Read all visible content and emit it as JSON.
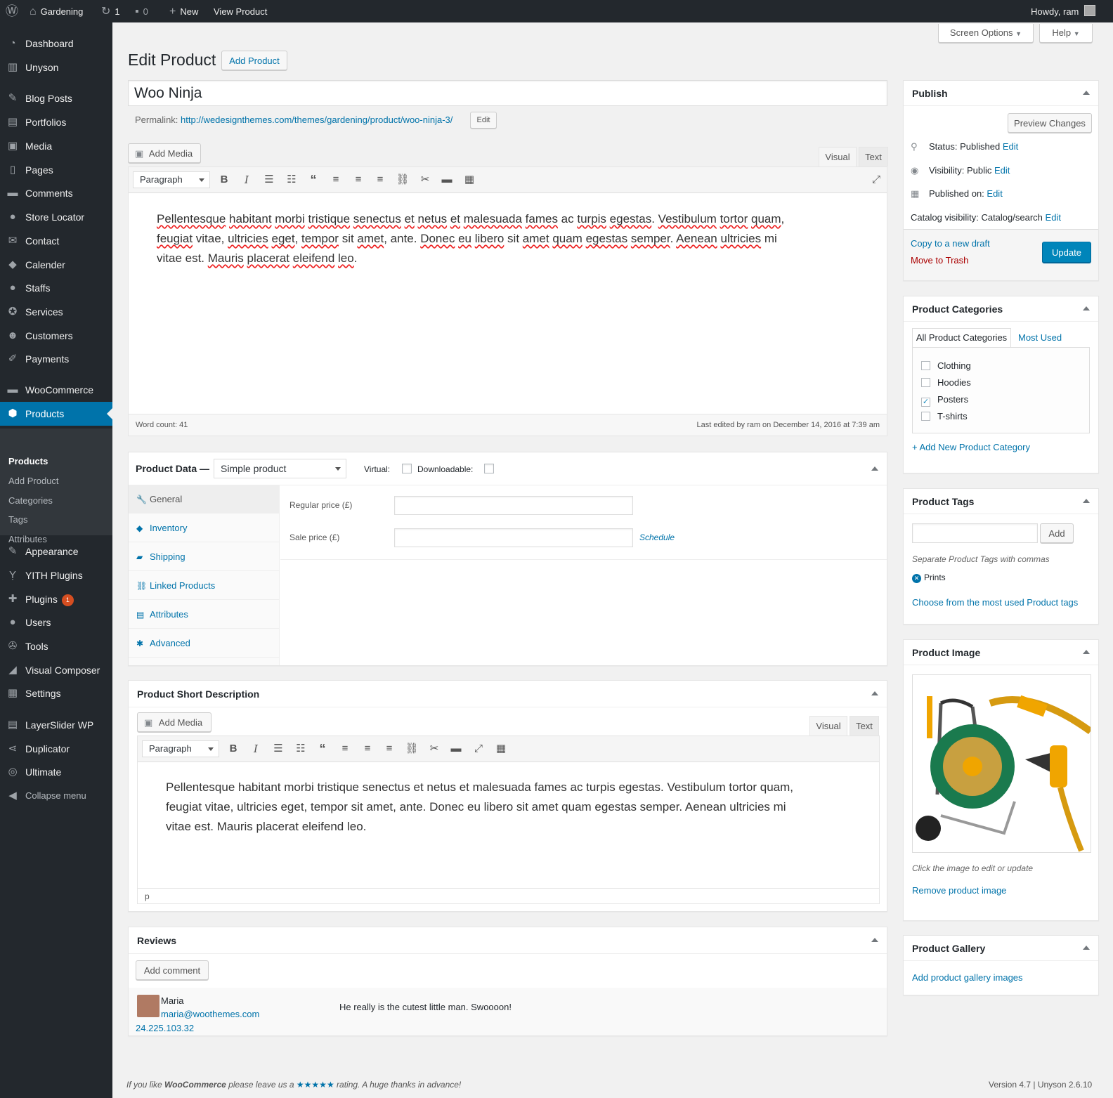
{
  "admin_bar": {
    "site_name": "Gardening",
    "updates_count": "1",
    "comments_count": "0",
    "new_label": "New",
    "view_label": "View Product",
    "howdy": "Howdy, ram"
  },
  "sidebar": {
    "items": [
      {
        "label": "Dashboard",
        "icon": "dashboard-icon"
      },
      {
        "label": "Unyson",
        "icon": "unyson-icon"
      },
      {
        "label": "Blog Posts",
        "icon": "pin-icon"
      },
      {
        "label": "Portfolios",
        "icon": "portfolio-icon"
      },
      {
        "label": "Media",
        "icon": "media-icon"
      },
      {
        "label": "Pages",
        "icon": "pages-icon"
      },
      {
        "label": "Comments",
        "icon": "comments-icon"
      },
      {
        "label": "Store Locator",
        "icon": "location-icon"
      },
      {
        "label": "Contact",
        "icon": "mail-icon"
      },
      {
        "label": "Calender",
        "icon": "tag-icon"
      },
      {
        "label": "Staffs",
        "icon": "users-icon"
      },
      {
        "label": "Services",
        "icon": "services-icon"
      },
      {
        "label": "Customers",
        "icon": "groups-icon"
      },
      {
        "label": "Payments",
        "icon": "edit-icon"
      },
      {
        "label": "WooCommerce",
        "icon": "woocommerce-icon"
      },
      {
        "label": "Products",
        "icon": "products-icon"
      },
      {
        "label": "Appearance",
        "icon": "appearance-icon"
      },
      {
        "label": "YITH Plugins",
        "icon": "yith-icon"
      },
      {
        "label": "Plugins",
        "icon": "plugins-icon",
        "badge": "1"
      },
      {
        "label": "Users",
        "icon": "users-icon"
      },
      {
        "label": "Tools",
        "icon": "tools-icon"
      },
      {
        "label": "Visual Composer",
        "icon": "vc-icon"
      },
      {
        "label": "Settings",
        "icon": "settings-icon"
      },
      {
        "label": "LayerSlider WP",
        "icon": "layers-icon"
      },
      {
        "label": "Duplicator",
        "icon": "share-icon"
      },
      {
        "label": "Ultimate",
        "icon": "shield-icon"
      },
      {
        "label": "Collapse menu",
        "icon": "collapse-icon"
      }
    ],
    "submenu": [
      "Products",
      "Add Product",
      "Categories",
      "Tags",
      "Attributes"
    ]
  },
  "screen_options": "Screen Options",
  "help": "Help",
  "page_title": "Edit Product",
  "add_product_button": "Add Product",
  "post_title": "Woo Ninja",
  "permalink": {
    "label": "Permalink:",
    "url": "http://wedesignthemes.com/themes/gardening/product/woo-ninja-3/",
    "edit": "Edit"
  },
  "editor": {
    "add_media": "Add Media",
    "tab_visual": "Visual",
    "tab_text": "Text",
    "format": "Paragraph",
    "content_words": [
      {
        "t": "Pellentesque",
        "w": true
      },
      {
        "t": " "
      },
      {
        "t": "habitant",
        "w": true
      },
      {
        "t": " "
      },
      {
        "t": "morbi",
        "w": true
      },
      {
        "t": " "
      },
      {
        "t": "tristique",
        "w": true
      },
      {
        "t": " "
      },
      {
        "t": "senectus",
        "w": true
      },
      {
        "t": " "
      },
      {
        "t": "et",
        "w": true
      },
      {
        "t": " "
      },
      {
        "t": "netus",
        "w": true
      },
      {
        "t": " "
      },
      {
        "t": "et",
        "w": true
      },
      {
        "t": " "
      },
      {
        "t": "malesuada",
        "w": true
      },
      {
        "t": " "
      },
      {
        "t": "fames",
        "w": true
      },
      {
        "t": " ac "
      },
      {
        "t": "turpis",
        "w": true
      },
      {
        "t": " "
      },
      {
        "t": "egestas",
        "w": true
      },
      {
        "t": ". "
      },
      {
        "t": "Vestibulum",
        "w": true
      },
      {
        "t": " "
      },
      {
        "t": "tortor",
        "w": true
      },
      {
        "t": " "
      },
      {
        "t": "quam",
        "w": true
      },
      {
        "t": ", "
      },
      {
        "t": "feugiat",
        "w": true
      },
      {
        "t": " vitae, "
      },
      {
        "t": "ultricies",
        "w": true
      },
      {
        "t": " "
      },
      {
        "t": "eget",
        "w": true
      },
      {
        "t": ", "
      },
      {
        "t": "tempor",
        "w": true
      },
      {
        "t": " sit "
      },
      {
        "t": "amet",
        "w": true
      },
      {
        "t": ", ante. "
      },
      {
        "t": "Donec",
        "w": true
      },
      {
        "t": " "
      },
      {
        "t": "eu",
        "w": true
      },
      {
        "t": " "
      },
      {
        "t": "libero",
        "w": true
      },
      {
        "t": " sit "
      },
      {
        "t": "amet",
        "w": true
      },
      {
        "t": " "
      },
      {
        "t": "quam",
        "w": true
      },
      {
        "t": " "
      },
      {
        "t": "egestas",
        "w": true
      },
      {
        "t": " "
      },
      {
        "t": "semper",
        "w": true
      },
      {
        "t": ". "
      },
      {
        "t": "Aenean",
        "w": true
      },
      {
        "t": " "
      },
      {
        "t": "ultricies",
        "w": true
      },
      {
        "t": " mi vitae est. "
      },
      {
        "t": "Mauris",
        "w": true
      },
      {
        "t": " "
      },
      {
        "t": "placerat",
        "w": true
      },
      {
        "t": " "
      },
      {
        "t": "eleifend",
        "w": true
      },
      {
        "t": " "
      },
      {
        "t": "leo",
        "w": true
      },
      {
        "t": "."
      }
    ],
    "word_count": "Word count: 41",
    "last_edited": "Last edited by ram on December 14, 2016 at 7:39 am"
  },
  "product_data": {
    "title": "Product Data —",
    "type": "Simple product",
    "virtual_label": "Virtual:",
    "downloadable_label": "Downloadable:",
    "tabs": [
      {
        "label": "General",
        "icon": "wrench-icon"
      },
      {
        "label": "Inventory",
        "icon": "inventory-icon"
      },
      {
        "label": "Shipping",
        "icon": "truck-icon"
      },
      {
        "label": "Linked Products",
        "icon": "link-icon"
      },
      {
        "label": "Attributes",
        "icon": "attributes-icon"
      },
      {
        "label": "Advanced",
        "icon": "gear-icon"
      }
    ],
    "regular_price_label": "Regular price (£)",
    "sale_price_label": "Sale price (£)",
    "schedule": "Schedule"
  },
  "short_description": {
    "title": "Product Short Description",
    "add_media": "Add Media",
    "tab_visual": "Visual",
    "tab_text": "Text",
    "format": "Paragraph",
    "content": "Pellentesque habitant morbi tristique senectus et netus et malesuada fames ac turpis egestas. Vestibulum tortor quam, feugiat vitae, ultricies eget, tempor sit amet, ante. Donec eu libero sit amet quam egestas semper. Aenean ultricies mi vitae est. Mauris placerat eleifend leo.",
    "path": "p"
  },
  "reviews": {
    "title": "Reviews",
    "add_comment": "Add comment",
    "author": "Maria",
    "email": "maria@woothemes.com",
    "ip": "24.225.103.32",
    "text": "He really is the cutest little man. Swoooon!"
  },
  "publish": {
    "title": "Publish",
    "preview": "Preview Changes",
    "status_label": "Status:",
    "status_value": "Published",
    "visibility_label": "Visibility:",
    "visibility_value": "Public",
    "published_on_label": "Published on:",
    "catalog_label": "Catalog visibility:",
    "catalog_value": "Catalog/search",
    "edit": "Edit",
    "copy_draft": "Copy to a new draft",
    "move_trash": "Move to Trash",
    "update": "Update"
  },
  "categories": {
    "title": "Product Categories",
    "tab_all": "All Product Categories",
    "tab_most": "Most Used",
    "items": [
      {
        "label": "Clothing",
        "checked": false
      },
      {
        "label": "Hoodies",
        "checked": false
      },
      {
        "label": "Posters",
        "checked": true
      },
      {
        "label": "T-shirts",
        "checked": false
      }
    ],
    "add_new": "+ Add New Product Category"
  },
  "tags": {
    "title": "Product Tags",
    "add": "Add",
    "hint": "Separate Product Tags with commas",
    "tag": "Prints",
    "choose": "Choose from the most used Product tags"
  },
  "product_image": {
    "title": "Product Image",
    "hint": "Click the image to edit or update",
    "remove": "Remove product image"
  },
  "gallery": {
    "title": "Product Gallery",
    "add": "Add product gallery images"
  },
  "footer": {
    "prefix": "If you like ",
    "brand": "WooCommerce",
    "middle": " please leave us a ",
    "stars": "★★★★★",
    "suffix": " rating. A huge thanks in advance!",
    "version": "Version 4.7 | Unyson 2.6.10"
  },
  "colors": {
    "accent": "#0073aa",
    "sidebar": "#23282d",
    "primary_button": "#0085ba",
    "trash": "#a00"
  }
}
